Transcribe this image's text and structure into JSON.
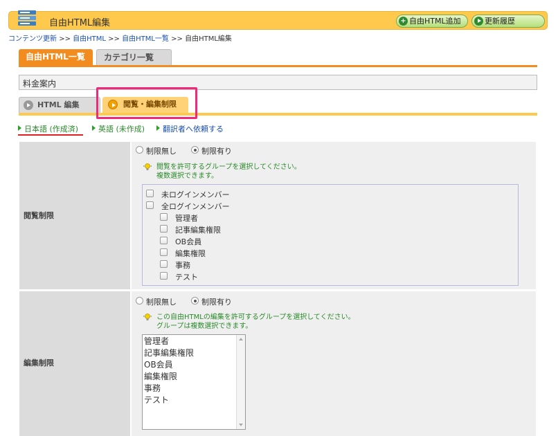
{
  "header": {
    "title": "自由HTML編集",
    "add_button": "自由HTML追加",
    "history_button": "更新履歴",
    "colors": {
      "bar": "#ffc94d",
      "button": "#b5df7c"
    }
  },
  "breadcrumb": [
    "コンテンツ更新",
    "自由HTML",
    "自由HTML一覧",
    "自由HTML編集"
  ],
  "breadcrumb_sep": ">>",
  "top_tabs": {
    "active": "自由HTML一覧",
    "inactive": "カテゴリ一覧"
  },
  "page_name": "料金案内",
  "edit_tabs": {
    "html": "HTML 編集",
    "permission": "閲覧・編集制限"
  },
  "languages": [
    {
      "label": "日本語 (作成済)"
    },
    {
      "label": "英語 (未作成)"
    },
    {
      "label": "翻訳者へ依頼する"
    }
  ],
  "view_restriction": {
    "label": "閲覧制限",
    "radio_none": "制限無し",
    "radio_restricted": "制限有り",
    "selected": "制限有り",
    "hint_line1": "閲覧を許可するグループを選択してください。",
    "hint_line2": "複数選択できます。",
    "groups": [
      "未ログインメンバー",
      "全ログインメンバー",
      "管理者",
      "記事編集権限",
      "OB会員",
      "編集権限",
      "事務",
      "テスト"
    ]
  },
  "edit_restriction": {
    "label": "編集制限",
    "radio_none": "制限無し",
    "radio_restricted": "制限有り",
    "selected": "制限有り",
    "hint_line1": "この自由HTMLの編集を許可するグループを選択してください。",
    "hint_line2": "グループは複数選択できます。",
    "groups": [
      "管理者",
      "記事編集権限",
      "OB会員",
      "編集権限",
      "事務",
      "テスト"
    ]
  }
}
